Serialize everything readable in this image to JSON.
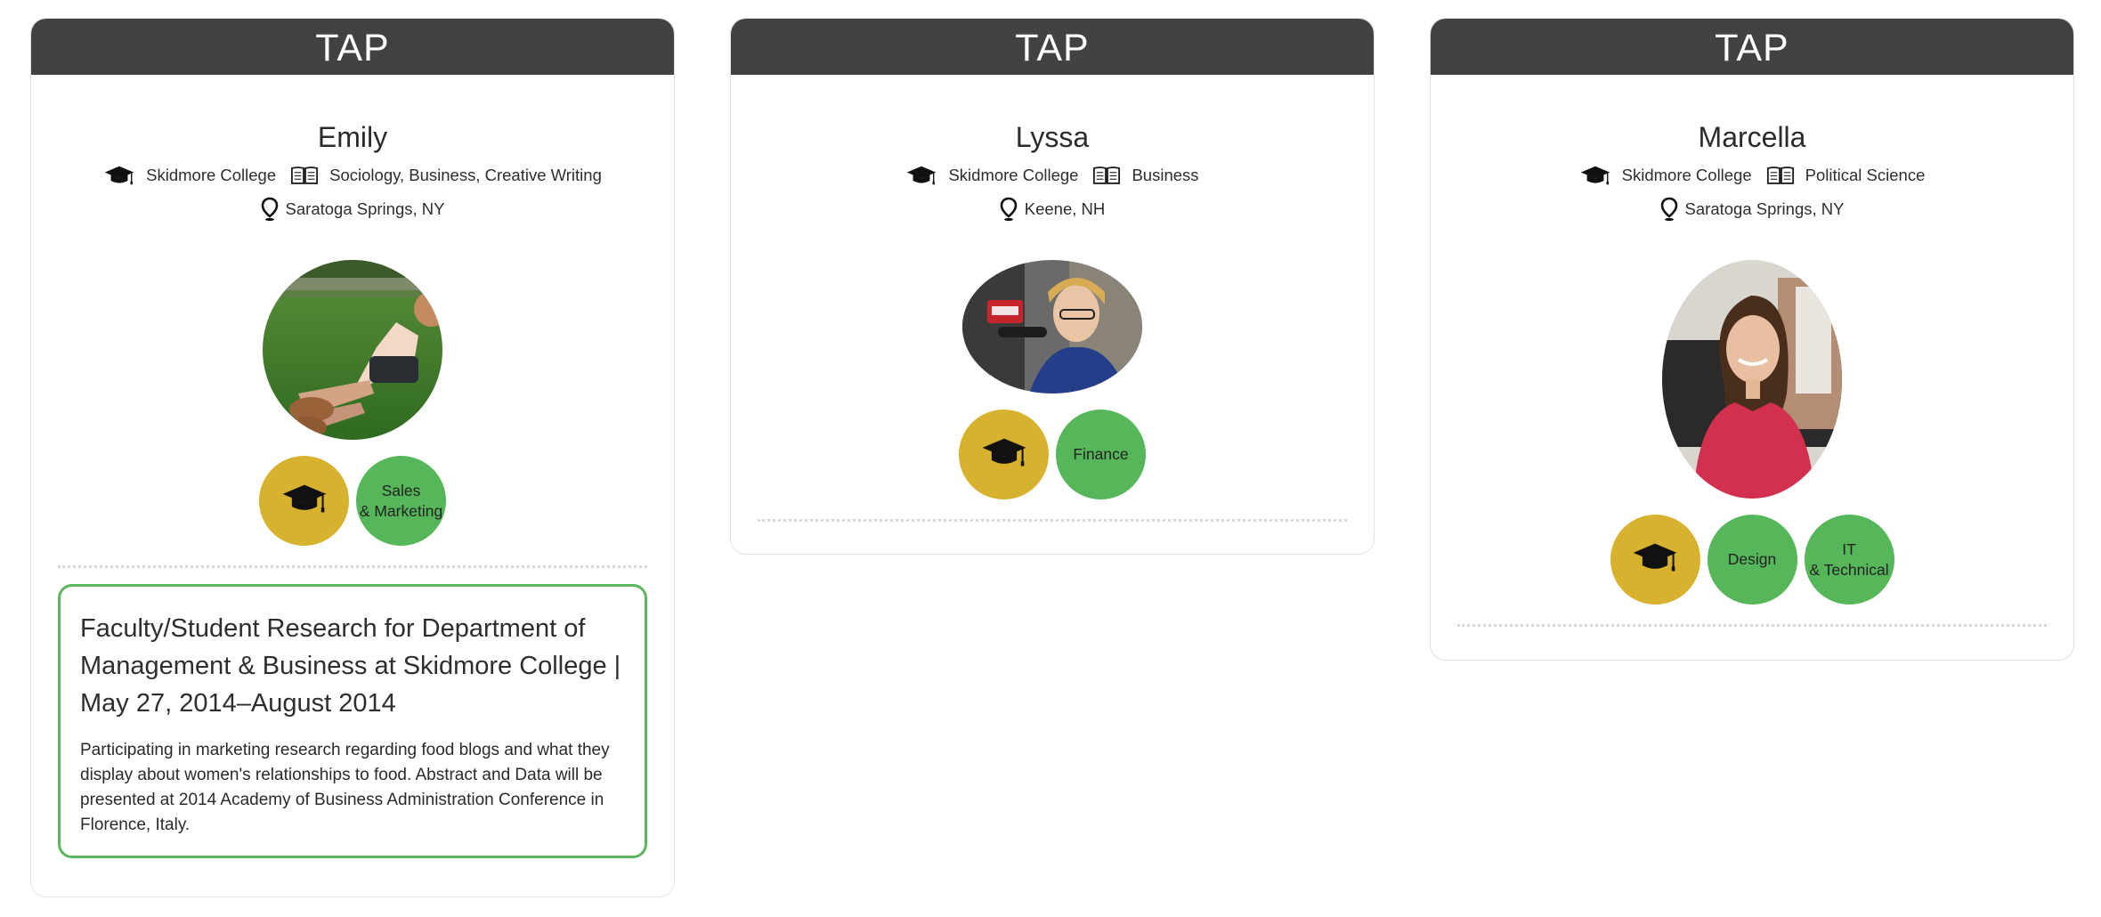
{
  "colors": {
    "header_bg": "#424242",
    "edu_badge": "#d7b22e",
    "skill_badge": "#56b75a",
    "experience_border": "#5cb85c"
  },
  "cards": [
    {
      "header": "TAP",
      "name": "Emily",
      "school": "Skidmore College",
      "majors": "Sociology, Business, Creative Writing",
      "location": "Saratoga Springs, NY",
      "photo_icon": "profile-photo-outdoor-lawn",
      "edu_badge_icon": "graduation-cap-icon",
      "skills": [
        "Sales\n& Marketing"
      ],
      "experience": {
        "title": "Faculty/Student Research for Department of Management & Business at Skidmore College | May 27, 2014–August 2014",
        "description": "Participating in marketing research regarding food blogs and what they display about women's relationships to food. Abstract and Data will be presented at 2014 Academy of Business Administration Conference in Florence, Italy."
      }
    },
    {
      "header": "TAP",
      "name": "Lyssa",
      "school": "Skidmore College",
      "majors": "Business",
      "location": "Keene, NH",
      "photo_icon": "profile-photo-radio-studio",
      "edu_badge_icon": "graduation-cap-icon",
      "skills": [
        "Finance"
      ]
    },
    {
      "header": "TAP",
      "name": "Marcella",
      "school": "Skidmore College",
      "majors": "Political Science",
      "location": "Saratoga Springs, NY",
      "photo_icon": "profile-photo-portrait",
      "edu_badge_icon": "graduation-cap-icon",
      "skills": [
        "Design",
        "IT\n& Technical"
      ]
    }
  ]
}
